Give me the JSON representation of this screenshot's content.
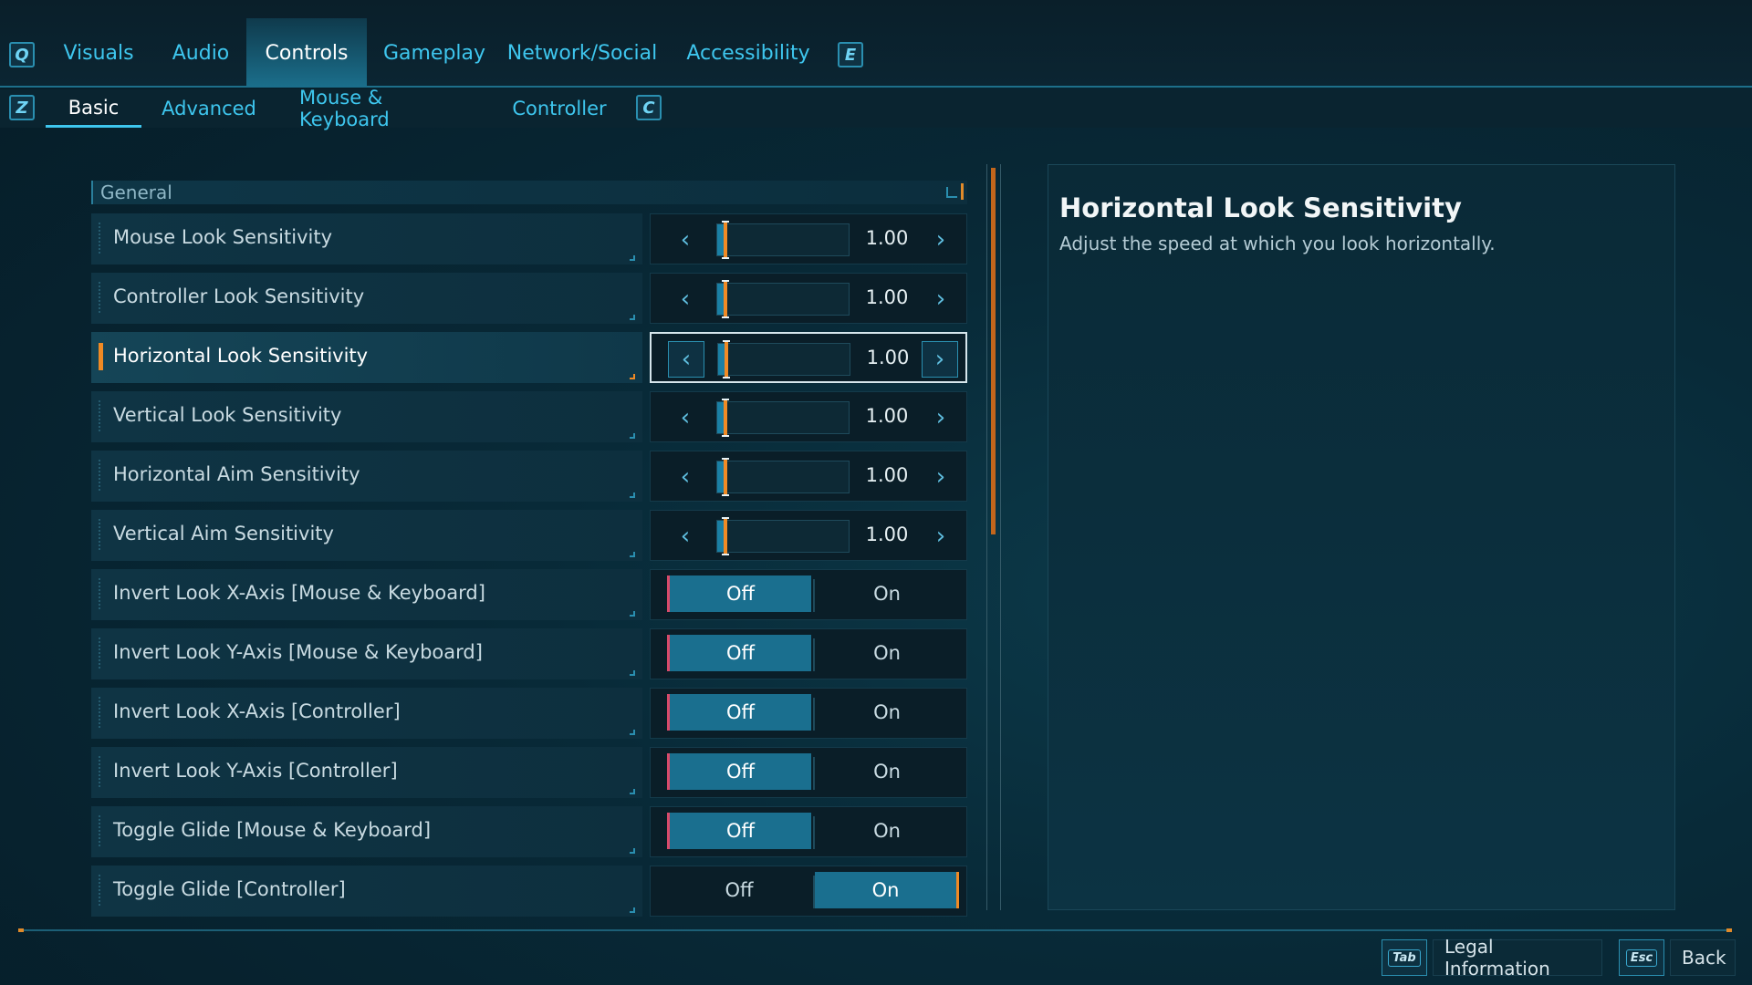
{
  "tabs": {
    "prev_key": "Q",
    "next_key": "E",
    "items": [
      {
        "label": "Visuals"
      },
      {
        "label": "Audio"
      },
      {
        "label": "Controls"
      },
      {
        "label": "Gameplay"
      },
      {
        "label": "Network/Social"
      },
      {
        "label": "Accessibility"
      }
    ],
    "active": "Controls"
  },
  "subtabs": {
    "prev_key": "Z",
    "next_key": "C",
    "items": [
      {
        "label": "Basic"
      },
      {
        "label": "Advanced"
      },
      {
        "label": "Mouse & Keyboard"
      },
      {
        "label": "Controller"
      }
    ],
    "active": "Basic"
  },
  "section": {
    "title": "General"
  },
  "settings": [
    {
      "label": "Mouse Look Sensitivity",
      "type": "slider",
      "value": "1.00",
      "fraction": 0.05
    },
    {
      "label": "Controller Look Sensitivity",
      "type": "slider",
      "value": "1.00",
      "fraction": 0.05
    },
    {
      "label": "Horizontal Look Sensitivity",
      "type": "slider",
      "value": "1.00",
      "fraction": 0.05,
      "selected": true
    },
    {
      "label": "Vertical Look Sensitivity",
      "type": "slider",
      "value": "1.00",
      "fraction": 0.05
    },
    {
      "label": "Horizontal Aim Sensitivity",
      "type": "slider",
      "value": "1.00",
      "fraction": 0.05
    },
    {
      "label": "Vertical Aim Sensitivity",
      "type": "slider",
      "value": "1.00",
      "fraction": 0.05
    },
    {
      "label": "Invert Look X-Axis [Mouse & Keyboard]",
      "type": "toggle",
      "off_label": "Off",
      "on_label": "On",
      "value": "Off"
    },
    {
      "label": "Invert Look Y-Axis [Mouse & Keyboard]",
      "type": "toggle",
      "off_label": "Off",
      "on_label": "On",
      "value": "Off"
    },
    {
      "label": "Invert Look X-Axis [Controller]",
      "type": "toggle",
      "off_label": "Off",
      "on_label": "On",
      "value": "Off"
    },
    {
      "label": "Invert Look Y-Axis [Controller]",
      "type": "toggle",
      "off_label": "Off",
      "on_label": "On",
      "value": "Off"
    },
    {
      "label": "Toggle Glide [Mouse & Keyboard]",
      "type": "toggle",
      "off_label": "Off",
      "on_label": "On",
      "value": "Off"
    },
    {
      "label": "Toggle Glide [Controller]",
      "type": "toggle",
      "off_label": "Off",
      "on_label": "On",
      "value": "On"
    }
  ],
  "description": {
    "title": "Horizontal Look Sensitivity",
    "text": "Adjust the speed at which you look horizontally."
  },
  "footer": {
    "legal_key": "Tab",
    "legal_label": "Legal Information",
    "back_key": "Esc",
    "back_label": "Back"
  },
  "colors": {
    "accent": "#3ec6ee",
    "highlight": "#f08a24",
    "active_fill": "#1a6f8f",
    "off_marker": "#d94a6a"
  },
  "icons": {
    "slider_left": "chevron-left-icon",
    "slider_right": "chevron-right-icon"
  }
}
